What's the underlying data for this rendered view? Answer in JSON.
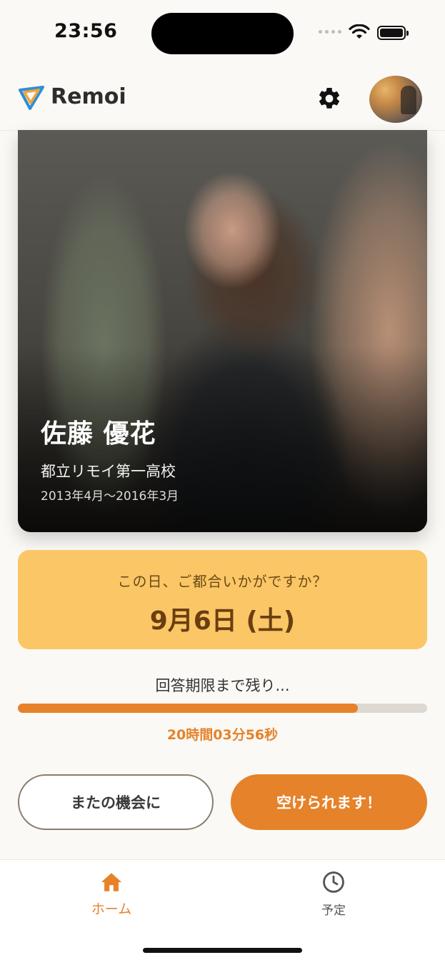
{
  "status_bar": {
    "time": "23:56"
  },
  "header": {
    "app_name": "Remoi"
  },
  "profile": {
    "name": "佐藤 優花",
    "school": "都立リモイ第一高校",
    "period": "2013年4月〜2016年3月"
  },
  "date_prompt": {
    "question": "この日、ご都合いかがですか？",
    "date": "9月6日 (土)"
  },
  "deadline": {
    "label": "回答期限まで残り...",
    "progress_fraction": 0.83,
    "countdown": "20時間03分56秒"
  },
  "actions": {
    "decline_label": "またの機会に",
    "accept_label": "空けられます！"
  },
  "bottom_nav": {
    "items": [
      {
        "label": "ホーム",
        "icon": "home-icon",
        "active": true
      },
      {
        "label": "予定",
        "icon": "clock-icon",
        "active": false
      }
    ]
  },
  "colors": {
    "accent": "#e6822a",
    "date_box": "#fbc665",
    "background": "#faf9f5"
  }
}
